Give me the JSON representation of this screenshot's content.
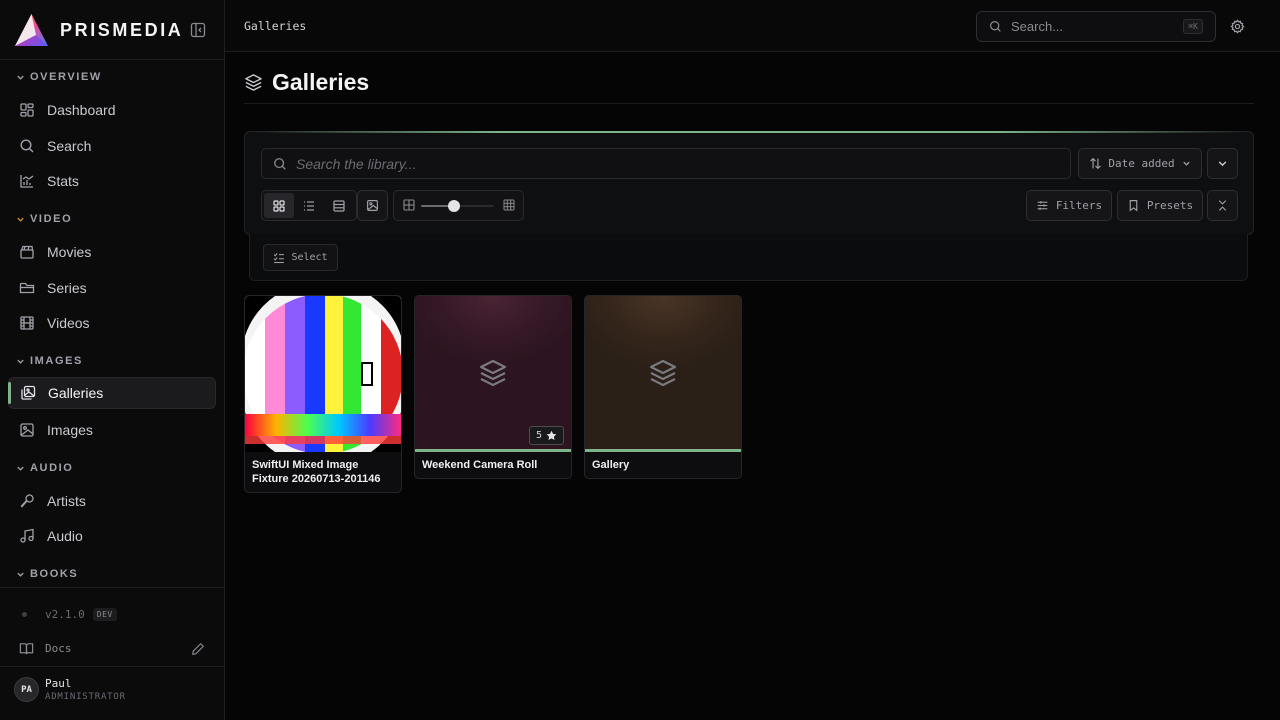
{
  "brand": {
    "name": "PRISMEDIA"
  },
  "sidebar": {
    "sections": [
      {
        "title": "OVERVIEW",
        "items": [
          {
            "label": "Dashboard",
            "icon": "dashboard-icon"
          },
          {
            "label": "Search",
            "icon": "search-icon"
          },
          {
            "label": "Stats",
            "icon": "stats-icon"
          }
        ]
      },
      {
        "title": "VIDEO",
        "items": [
          {
            "label": "Movies",
            "icon": "film-icon"
          },
          {
            "label": "Series",
            "icon": "folder-icon"
          },
          {
            "label": "Videos",
            "icon": "video-icon"
          }
        ]
      },
      {
        "title": "IMAGES",
        "items": [
          {
            "label": "Galleries",
            "icon": "gallery-icon",
            "active": true
          },
          {
            "label": "Images",
            "icon": "image-icon"
          }
        ]
      },
      {
        "title": "AUDIO",
        "items": [
          {
            "label": "Artists",
            "icon": "mic-icon"
          },
          {
            "label": "Audio",
            "icon": "music-icon"
          }
        ]
      },
      {
        "title": "BOOKS",
        "items": []
      }
    ],
    "version": "v2.1.0",
    "version_badge": "DEV",
    "docs_label": "Docs",
    "user": {
      "initials": "PA",
      "name": "Paul",
      "role": "ADMINISTRATOR"
    }
  },
  "topbar": {
    "breadcrumb": "Galleries",
    "search_placeholder": "Search...",
    "shortcut": "⌘K"
  },
  "page": {
    "title": "Galleries"
  },
  "toolbar": {
    "search_placeholder": "Search the library...",
    "sort_label": "Date added",
    "filters_label": "Filters",
    "presets_label": "Presets",
    "select_label": "Select",
    "zoom_level": 0.45,
    "active_view": "grid"
  },
  "galleries": [
    {
      "title": "SwiftUI Mixed Image Fixture 20260713-201146",
      "thumbnail": "test-pattern"
    },
    {
      "title": "Weekend Camera Roll",
      "thumbnail": "placeholder-plum",
      "count": "5"
    },
    {
      "title": "Gallery",
      "thumbnail": "placeholder-brown"
    }
  ],
  "colors": {
    "accent": "#7fb389",
    "background": "#050505",
    "sidebar": "#0b0b0c",
    "plum": "#3d1a2a",
    "brown": "#3a281c"
  }
}
